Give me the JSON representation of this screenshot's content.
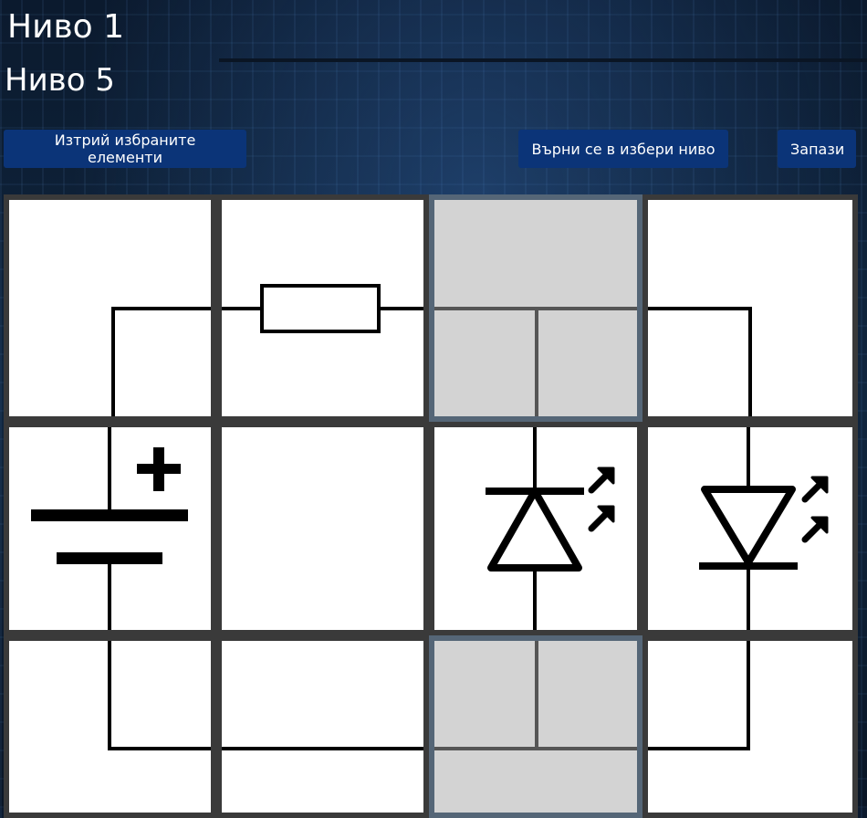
{
  "level_titles": {
    "behind": "Ниво 1",
    "current": "Ниво 5"
  },
  "toolbar": {
    "delete_label": "Изтрий избраните елементи",
    "back_label": "Върни се в избери ниво",
    "save_label": "Запази"
  },
  "board": {
    "rows": 3,
    "cols": 4,
    "cells": [
      {
        "row": 0,
        "col": 0,
        "element": "wire-corner-right-down",
        "selected": false
      },
      {
        "row": 0,
        "col": 1,
        "element": "resistor-horizontal",
        "selected": false
      },
      {
        "row": 0,
        "col": 2,
        "element": "wire-tee-down",
        "selected": true
      },
      {
        "row": 0,
        "col": 3,
        "element": "wire-corner-left-down",
        "selected": false
      },
      {
        "row": 1,
        "col": 0,
        "element": "battery-vertical",
        "selected": false
      },
      {
        "row": 1,
        "col": 1,
        "element": "empty",
        "selected": false
      },
      {
        "row": 1,
        "col": 2,
        "element": "led-up",
        "selected": false
      },
      {
        "row": 1,
        "col": 3,
        "element": "led-down",
        "selected": false
      },
      {
        "row": 2,
        "col": 0,
        "element": "wire-corner-up-right",
        "selected": false
      },
      {
        "row": 2,
        "col": 1,
        "element": "wire-horizontal",
        "selected": false
      },
      {
        "row": 2,
        "col": 2,
        "element": "wire-tee-up",
        "selected": true
      },
      {
        "row": 2,
        "col": 3,
        "element": "wire-corner-up-left",
        "selected": false
      }
    ]
  },
  "colors": {
    "button_bg": "#0b3478",
    "cell_border": "#3a3a3a",
    "selected_bg": "#d3d3d3",
    "wire": "#000000"
  }
}
